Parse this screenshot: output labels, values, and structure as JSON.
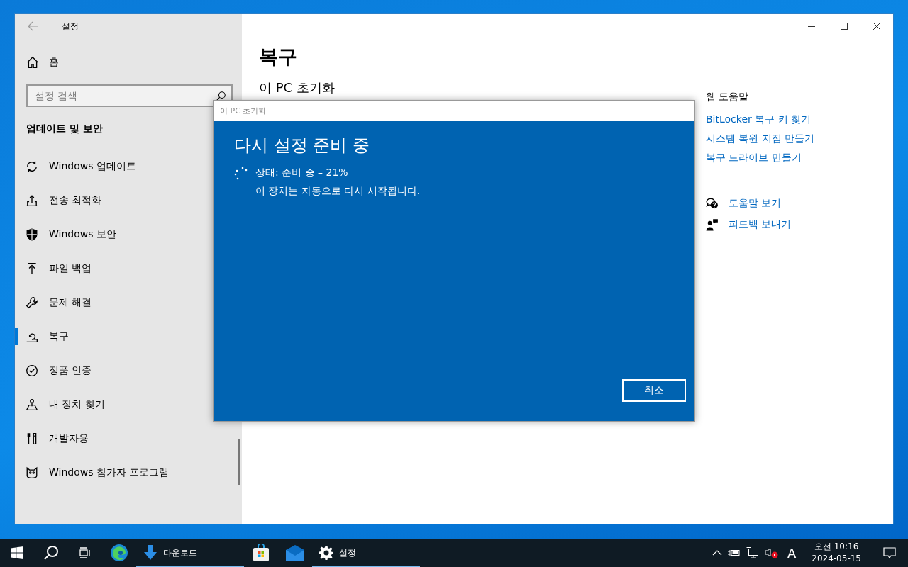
{
  "window": {
    "title": "설정"
  },
  "sidebar": {
    "home": "홈",
    "search": {
      "placeholder": "설정 검색"
    },
    "section": "업데이트 및 보안",
    "items": [
      {
        "kind": "sync",
        "label": "Windows 업데이트",
        "selected": false
      },
      {
        "kind": "delivery",
        "label": "전송 최적화",
        "selected": false
      },
      {
        "kind": "shield",
        "label": "Windows 보안",
        "selected": false
      },
      {
        "kind": "backup",
        "label": "파일 백업",
        "selected": false
      },
      {
        "kind": "wrench",
        "label": "문제 해결",
        "selected": false
      },
      {
        "kind": "recovery",
        "label": "복구",
        "selected": true
      },
      {
        "kind": "check",
        "label": "정품 인증",
        "selected": false
      },
      {
        "kind": "find",
        "label": "내 장치 찾기",
        "selected": false
      },
      {
        "kind": "dev",
        "label": "개발자용",
        "selected": false
      },
      {
        "kind": "insider",
        "label": "Windows 참가자 프로그램",
        "selected": false
      }
    ]
  },
  "content": {
    "title": "복구",
    "subheading": "이 PC 초기화",
    "web_help": {
      "title": "웹 도움말",
      "links": [
        "BitLocker 복구 키 찾기",
        "시스템 복원 지점 만들기",
        "복구 드라이브 만들기"
      ]
    },
    "help_links": [
      {
        "kind": "help",
        "label": "도움말 보기"
      },
      {
        "kind": "feedback",
        "label": "피드백 보내기"
      }
    ]
  },
  "dialog": {
    "title": "이 PC 초기화",
    "heading": "다시 설정 준비 중",
    "status": "상태: 준비 중 – 21%",
    "message": "이 장치는 자동으로 다시 시작됩니다.",
    "cancel": "취소"
  },
  "taskbar": {
    "apps": [
      {
        "kind": "edge",
        "active": false
      },
      {
        "kind": "download",
        "label": "다운로드",
        "active": true
      },
      {
        "kind": "store",
        "active": false
      },
      {
        "kind": "mail",
        "active": false
      },
      {
        "kind": "settings",
        "label": "설정",
        "active": true
      }
    ],
    "ime": "A",
    "time": "오전 10:16",
    "date": "2024-05-15"
  }
}
